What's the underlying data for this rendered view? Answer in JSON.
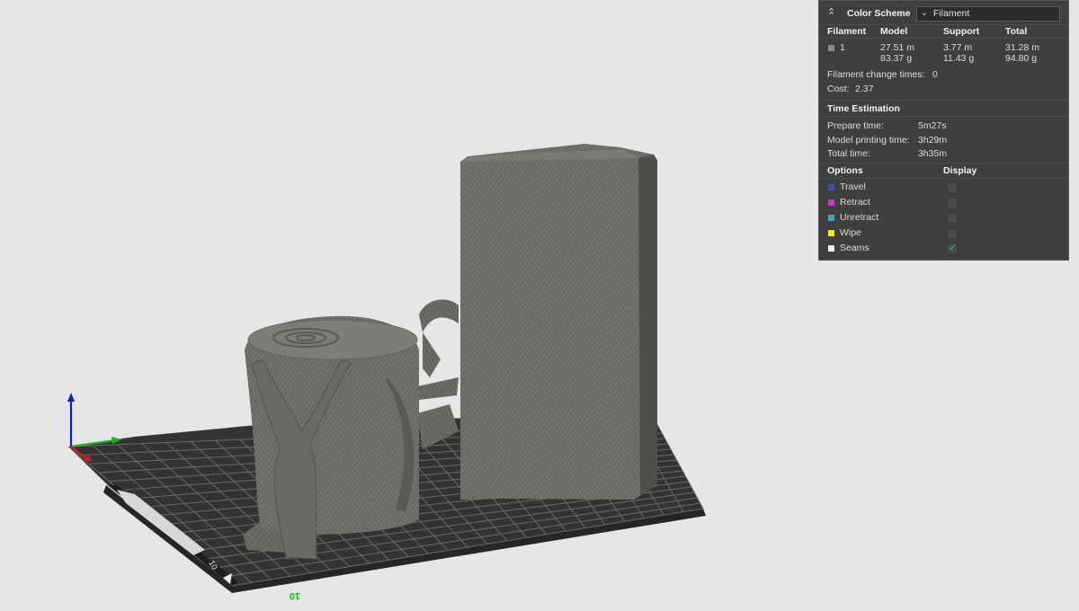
{
  "colors": {
    "background": "#e6e6e6",
    "panel_bg": "#3f3f3f",
    "bed_dark": "#2f2f2f",
    "model_gray": "#6f6f69",
    "travel": "#3b4fc6",
    "retract": "#cc34c9",
    "unretract": "#3ba4c9",
    "wipe": "#f0ec14",
    "seams": "#f2f2f2",
    "axis_x": "#cc2020",
    "axis_y": "#20b020",
    "axis_z": "#1020c0"
  },
  "viewport": {
    "bed_label_y": "10",
    "bed_label_x": "10",
    "axes_icon": "xyz-axes-icon"
  },
  "panel": {
    "collapse_icon": "double-chevron-up-icon",
    "color_scheme_label": "Color Scheme",
    "color_scheme_value": "Filament",
    "headers": {
      "filament": "Filament",
      "model": "Model",
      "support": "Support",
      "total": "Total"
    },
    "filament_rows": [
      {
        "id": "1",
        "swatch_color": "#8a8a8a",
        "model_length": "27.51 m",
        "model_weight": "83.37 g",
        "support_length": "3.77 m",
        "support_weight": "11.43 g",
        "total_length": "31.28 m",
        "total_weight": "94.80 g"
      }
    ],
    "change_times_label": "Filament change times:",
    "change_times_value": "0",
    "cost_label": "Cost:",
    "cost_value": "2.37",
    "time_header": "Time Estimation",
    "prepare_label": "Prepare time:",
    "prepare_value": "5m27s",
    "model_time_label": "Model printing time:",
    "model_time_value": "3h29m",
    "total_time_label": "Total time:",
    "total_time_value": "3h35m",
    "options_header": "Options",
    "display_header": "Display",
    "options": [
      {
        "label": "Travel",
        "color": "#3b4fc6",
        "checked": false
      },
      {
        "label": "Retract",
        "color": "#cc34c9",
        "checked": false
      },
      {
        "label": "Unretract",
        "color": "#3ba4c9",
        "checked": false
      },
      {
        "label": "Wipe",
        "color": "#f0ec14",
        "checked": false
      },
      {
        "label": "Seams",
        "color": "#f2f2f2",
        "checked": true
      }
    ]
  }
}
